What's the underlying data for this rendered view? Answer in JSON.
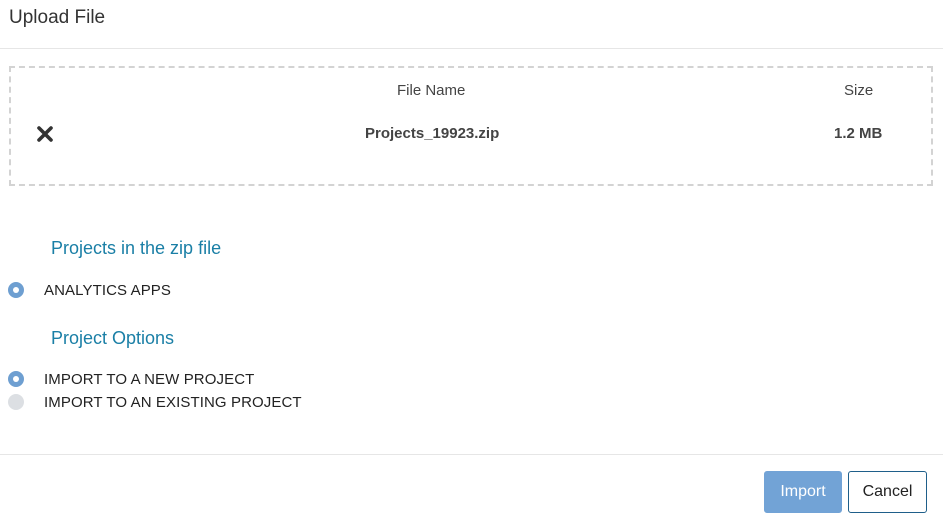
{
  "dialog": {
    "title": "Upload File"
  },
  "upload": {
    "columns": {
      "file_name": "File Name",
      "size": "Size"
    },
    "file": {
      "name": "Projects_19923.zip",
      "size": "1.2 MB"
    },
    "remove_icon": "close-x-icon"
  },
  "projects_section": {
    "title": "Projects in the zip file",
    "items": [
      {
        "label": "ANALYTICS APPS",
        "selected": true
      }
    ]
  },
  "options_section": {
    "title": "Project Options",
    "items": [
      {
        "label": "IMPORT TO A NEW PROJECT",
        "selected": true
      },
      {
        "label": "IMPORT TO AN EXISTING PROJECT",
        "selected": false
      }
    ]
  },
  "footer": {
    "import_label": "Import",
    "cancel_label": "Cancel"
  },
  "colors": {
    "section_title": "#1a7fa6",
    "radio_checked": "#6e9fd1",
    "import_button": "#72a3d6",
    "cancel_border": "#1f5f8a"
  }
}
